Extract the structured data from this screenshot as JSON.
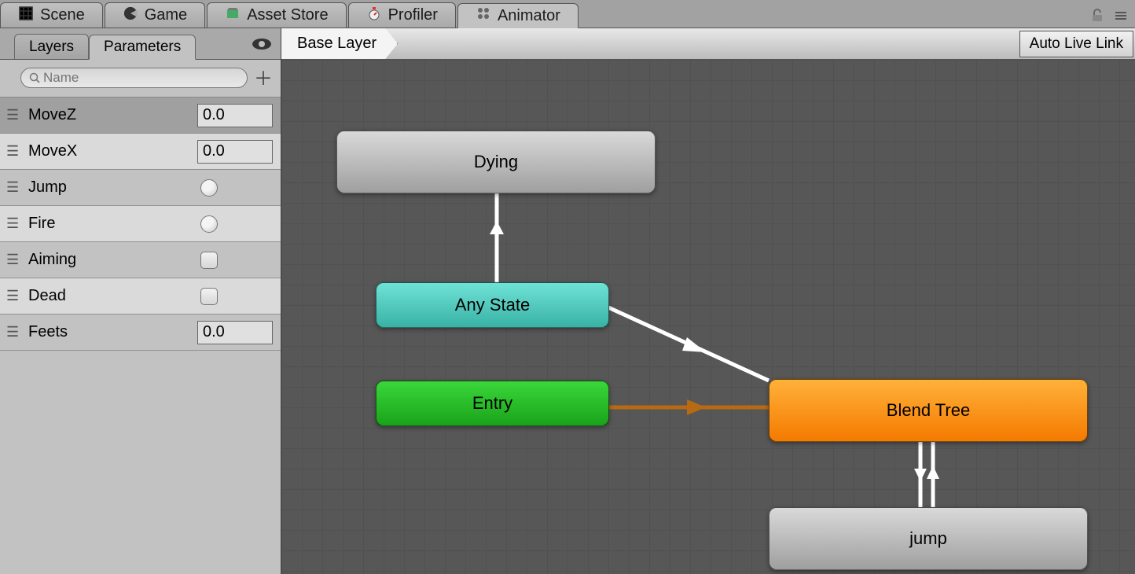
{
  "tabs": {
    "scene": "Scene",
    "game": "Game",
    "asset_store": "Asset Store",
    "profiler": "Profiler",
    "animator": "Animator"
  },
  "left": {
    "subtabs": {
      "layers": "Layers",
      "parameters": "Parameters"
    },
    "search_placeholder": "Name",
    "params": [
      {
        "name": "MoveZ",
        "kind": "float",
        "value": "0.0",
        "selected": true
      },
      {
        "name": "MoveX",
        "kind": "float",
        "value": "0.0"
      },
      {
        "name": "Jump",
        "kind": "trigger"
      },
      {
        "name": "Fire",
        "kind": "trigger"
      },
      {
        "name": "Aiming",
        "kind": "bool"
      },
      {
        "name": "Dead",
        "kind": "bool"
      },
      {
        "name": "Feets",
        "kind": "float",
        "value": "0.0"
      }
    ]
  },
  "graph": {
    "layer_name": "Base Layer",
    "auto_live_link": "Auto Live Link",
    "nodes": {
      "dying": "Dying",
      "any_state": "Any State",
      "entry": "Entry",
      "blend_tree": "Blend Tree",
      "jump": "jump"
    }
  }
}
